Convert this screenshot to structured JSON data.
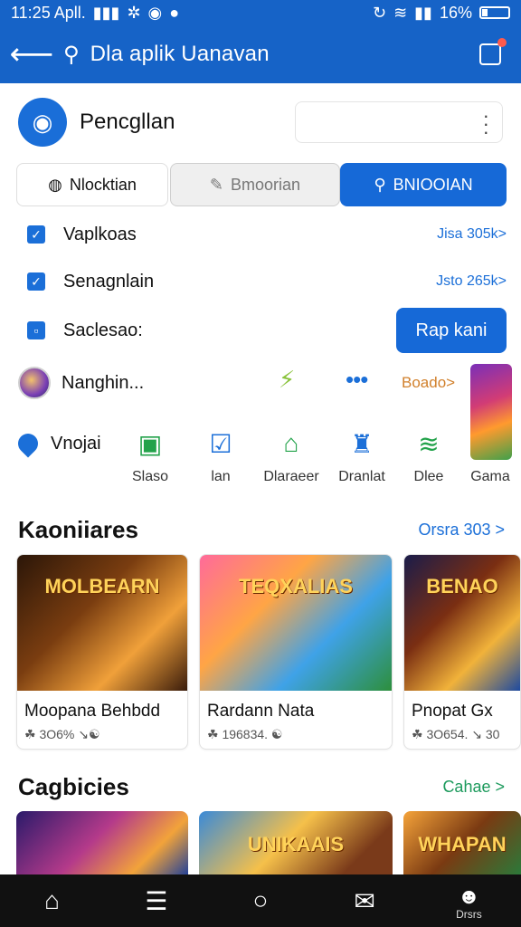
{
  "status_bar": {
    "time": "11:25 Apll.",
    "battery": "16%"
  },
  "app_bar": {
    "title": "Dla aplik Uanavan"
  },
  "header": {
    "app_name": "Pencgllan"
  },
  "segments": [
    {
      "label": "Nlocktian"
    },
    {
      "label": "Bmoorian"
    },
    {
      "label": "BNIOOIAN"
    }
  ],
  "options": [
    {
      "label": "Vaplkoas",
      "meta": "Jisa 305k>"
    },
    {
      "label": "Senagnlain",
      "meta": "Jsto 265k>"
    },
    {
      "label": "Saclesao:",
      "button": "Rap kani"
    }
  ],
  "profile_row": {
    "label": "Nanghin...",
    "promo": "Boado>"
  },
  "shortcuts": [
    {
      "label": "",
      "title": "Vnojai",
      "icon": "location-pin-icon"
    },
    {
      "label": "Slaso",
      "icon": "green-share-icon"
    },
    {
      "label": "lan",
      "icon": "blue-check-shield-icon"
    },
    {
      "label": "Dlaraeer",
      "icon": "green-store-icon"
    },
    {
      "label": "Dranlat",
      "icon": "blue-puzzle-icon"
    },
    {
      "label": "Dlee",
      "icon": "green-wifi-icon"
    },
    {
      "label": "Gama",
      "icon": "game-thumbnail"
    }
  ],
  "section1": {
    "title": "Kaoniiares",
    "link": "Orsra 303 >",
    "cards": [
      {
        "title": "Moopana Behbdd",
        "meta": "☘ 3O6%  ↘☯",
        "art_text": "MOLBEARN"
      },
      {
        "title": "Rardann Nata",
        "meta": "☘ 196834.  ☯",
        "art_text": "TEQXALIAS"
      },
      {
        "title": "Pnopat Gx",
        "meta": "☘ 3O654.  ↘ 30",
        "art_text": "BENAO"
      }
    ]
  },
  "section2": {
    "title": "Cagbicies",
    "link": "Cahae >",
    "cards": [
      {
        "art_text": ""
      },
      {
        "art_text": "UNIKAAIS"
      },
      {
        "art_text": "WHAPAN"
      }
    ]
  },
  "bottom_nav": [
    {
      "icon": "home-icon",
      "label": ""
    },
    {
      "icon": "menu-icon",
      "label": ""
    },
    {
      "icon": "circle-icon",
      "label": ""
    },
    {
      "icon": "mail-icon",
      "label": ""
    },
    {
      "icon": "profile-icon",
      "label": "Drsrs"
    }
  ]
}
